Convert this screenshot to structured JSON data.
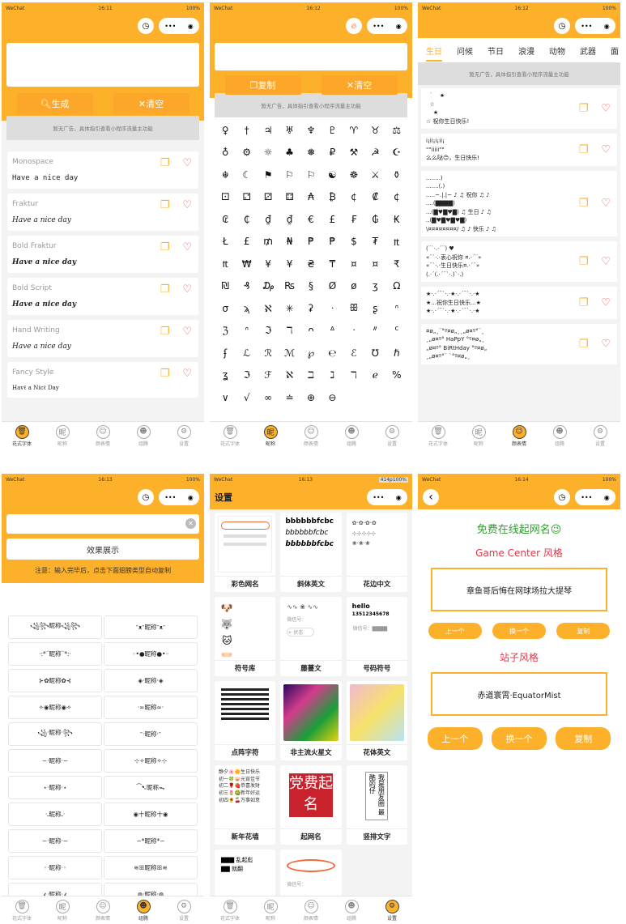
{
  "status": {
    "carrier": "WeChat",
    "battery": "100%",
    "t1": "16:11",
    "t2": "16:12",
    "t3": "16:12",
    "t4": "16:13",
    "t5": "16:13",
    "t6": "16:14",
    "extra5": "414p"
  },
  "capsule": {
    "dots": "•••",
    "target": "◉",
    "clock": "◷"
  },
  "tabs": [
    {
      "label": "花式字体",
      "icon": "trash-icon"
    },
    {
      "label": "昵称",
      "icon": "nickname-icon"
    },
    {
      "label": "颜表情",
      "icon": "smile-icon"
    },
    {
      "label": "组腾",
      "icon": "tongue-icon"
    },
    {
      "label": "设置",
      "icon": "gear-icon"
    }
  ],
  "screen1": {
    "input_text": "",
    "generate": "生成",
    "clear": "清空",
    "ad": "暂无广告，具体指引查看小程序流量主功能",
    "fonts": [
      {
        "name": "Monospace",
        "sample": "Have a nice day"
      },
      {
        "name": "Fraktur",
        "sample": "Have a nice day"
      },
      {
        "name": "Bold Fraktur",
        "sample": "Have a nice day"
      },
      {
        "name": "Bold Script",
        "sample": "Have a nice day"
      },
      {
        "name": "Hand Writing",
        "sample": "Have a nice day"
      },
      {
        "name": "Fancy Style",
        "sample": "Havℓ a Nicℓ Day"
      }
    ]
  },
  "screen2": {
    "copy": "复制",
    "clear": "清空",
    "ad": "暂无广告，具体指引查看小程序流量主功能",
    "symbols": [
      "♀",
      "†",
      "♃",
      "♅",
      "♆",
      "♇",
      "♈",
      "♉",
      "⚖",
      "♁",
      "⚙",
      "☼",
      "♣",
      "❅",
      "₽",
      "⚒",
      "☭",
      "☪",
      "☬",
      "☾",
      "⚑",
      "⚐",
      "⚐",
      "☯",
      "☸",
      "⚔",
      "⚱",
      "⚀",
      "⚁",
      "⚂",
      "⚃",
      "₳",
      "₿",
      "¢",
      "₡",
      "¢",
      "₢",
      "₵",
      "₫",
      "₫",
      "€",
      "£",
      "₣",
      "₲",
      "₭",
      "Ł",
      "£",
      "₥",
      "₦",
      "₱",
      "₱",
      "$",
      "₮",
      "₶",
      "₶",
      "₩",
      "¥",
      "¥",
      "₴",
      "₸",
      "¤",
      "¤",
      "₹",
      "₪",
      "₰",
      "₯",
      "₨",
      "§",
      "Ø",
      "ø",
      "ʒ",
      "Ω",
      "σ",
      "ϡ",
      "ℵ",
      "✳",
      "ʡ",
      "ᐧ",
      "ꕥ",
      "ʂ",
      "ᐢ",
      "ℨ",
      "ᐢ",
      "ℑ",
      "ℸ",
      "ᴖ",
      "ᐞ",
      "ᐧ",
      "ᐥ",
      "ᑦ",
      "ʄ",
      "ℒ",
      "ℛ",
      "ℳ",
      "℘",
      "℮",
      "ℰ",
      "℧",
      "ℏ",
      "ʓ",
      "ℑ",
      "ℱ",
      "ℵ",
      "ℶ",
      "ℷ",
      "ℸ",
      "ℯ",
      "%",
      "∨",
      "√",
      "∞",
      "≐",
      "⊕",
      "⊖"
    ]
  },
  "screen3": {
    "cats": [
      "生日",
      "问候",
      "节日",
      "浪漫",
      "动物",
      "武器",
      "面"
    ],
    "ad": "暂无广告，具体指引查看小程序流量主功能",
    "blessings": [
      "  ˙    ★\n  ☆\n    ★\n☆ 祝你生日快乐!",
      "ⅰ¡ⅰⅰ¡ⅰ¡ⅰⅰ¡\n\"\"ⅰⅰⅰⅰⅰ\"\"\n么么哒😊，生日快乐!",
      "........)\n.......(.)\n.....~.|.|~ ♪ ♫ 祝你 ♫ ♪\n....(▇▇▇▇)\n...(▇♥▇♥▇) ♫ 生日 ♪ ♫\n..(▇♥▇♥▇♥▇)\n\\¤¤¤¤¤¤¤¤/ ♫ ♪ 快乐 ♪ ♫",
      "(¨`·.·´¨) ♥\n«¨`·.·衷心祝你 ¤.·´¨»\n«¨`·.·生日快乐¤.·´¨»\n(.·´(.·´¨`·.)`·.)",
      "★·.·´¯`·.·★·.·´¯`·.·★\n★...祝你生日快乐...★\n★·.·´¯`·.·★·.·´¯`·.·★",
      "¤ø„¸¨°º¤ø„¸¸„ø¤º°¨¸\n¸„ø¤º° HaPpY °º¤ø„¸\n„ø¤º° BiRtHday °º¤ø„\n¸„ø¤º°¨ `°º¤ø„¸"
    ]
  },
  "screen4": {
    "input_text": "",
    "show_btn": "效果展示",
    "note": "注意：输入完毕后，点击下面翅膀类型自动复制",
    "nicks": [
      "꧁꧂昵称꧁꧂",
      "ᵔᴥᵔ昵称ᵔᴥᵔ",
      "·:*¨昵称¨*:·",
      "◦•●昵称●•◦",
      "⊱✿昵称✿⊰",
      "◈·昵称·◈",
      "✧◉昵称◉✧",
      "·∞昵称∞·",
      "꧁·昵称·꧂",
      "ᵔ·昵称·ᵔ",
      "∽·昵称·∽",
      "⊹✧昵称✧⊹",
      "⋆·昵称·⋆",
      "⁀➷昵称ᯓ",
      "·ـ昵称ـ·",
      "◉十昵称十◉",
      "∼·昵称·∼",
      "∽*昵称*∽",
      "◦·昵称·◦",
      "≋ꕥ昵称ꕥ≋",
      "⸙·昵称·⸙",
      "◍·昵称·◍",
      "⟡·昵称·⟡",
      "ʚ·昵称·ɞ",
      "⟣·昵称·⟢",
      "≀·昵称·≀"
    ]
  },
  "screen5": {
    "title": "设置",
    "items": [
      "彩色网名",
      "斜体英文",
      "花边中文",
      "符号库",
      "藤蔓文",
      "号码符号",
      "点阵字符",
      "非主流火星文",
      "花体英文",
      "新年花墙",
      "起网名",
      "竖排文字",
      "",
      ""
    ],
    "seal": "党费起名",
    "vertical": "我是朋友圈 最酷的仔",
    "hello": "hello",
    "hello_num": "13512345678",
    "style_text": "bbbbbbfcbc",
    "wechat": "微信号：",
    "status_btn": "+ 状态"
  },
  "screen6": {
    "title": "免费在线起网名",
    "emoji": "😉",
    "sec1": "Game Center 风格",
    "name1": "章鱼哥后悔在网球场拉大提琴",
    "sec2": "站子风格",
    "name2": "赤道寰霄·EquatorMist",
    "prev": "上一个",
    "next": "换一个",
    "copy": "复制",
    "back": "‹"
  }
}
